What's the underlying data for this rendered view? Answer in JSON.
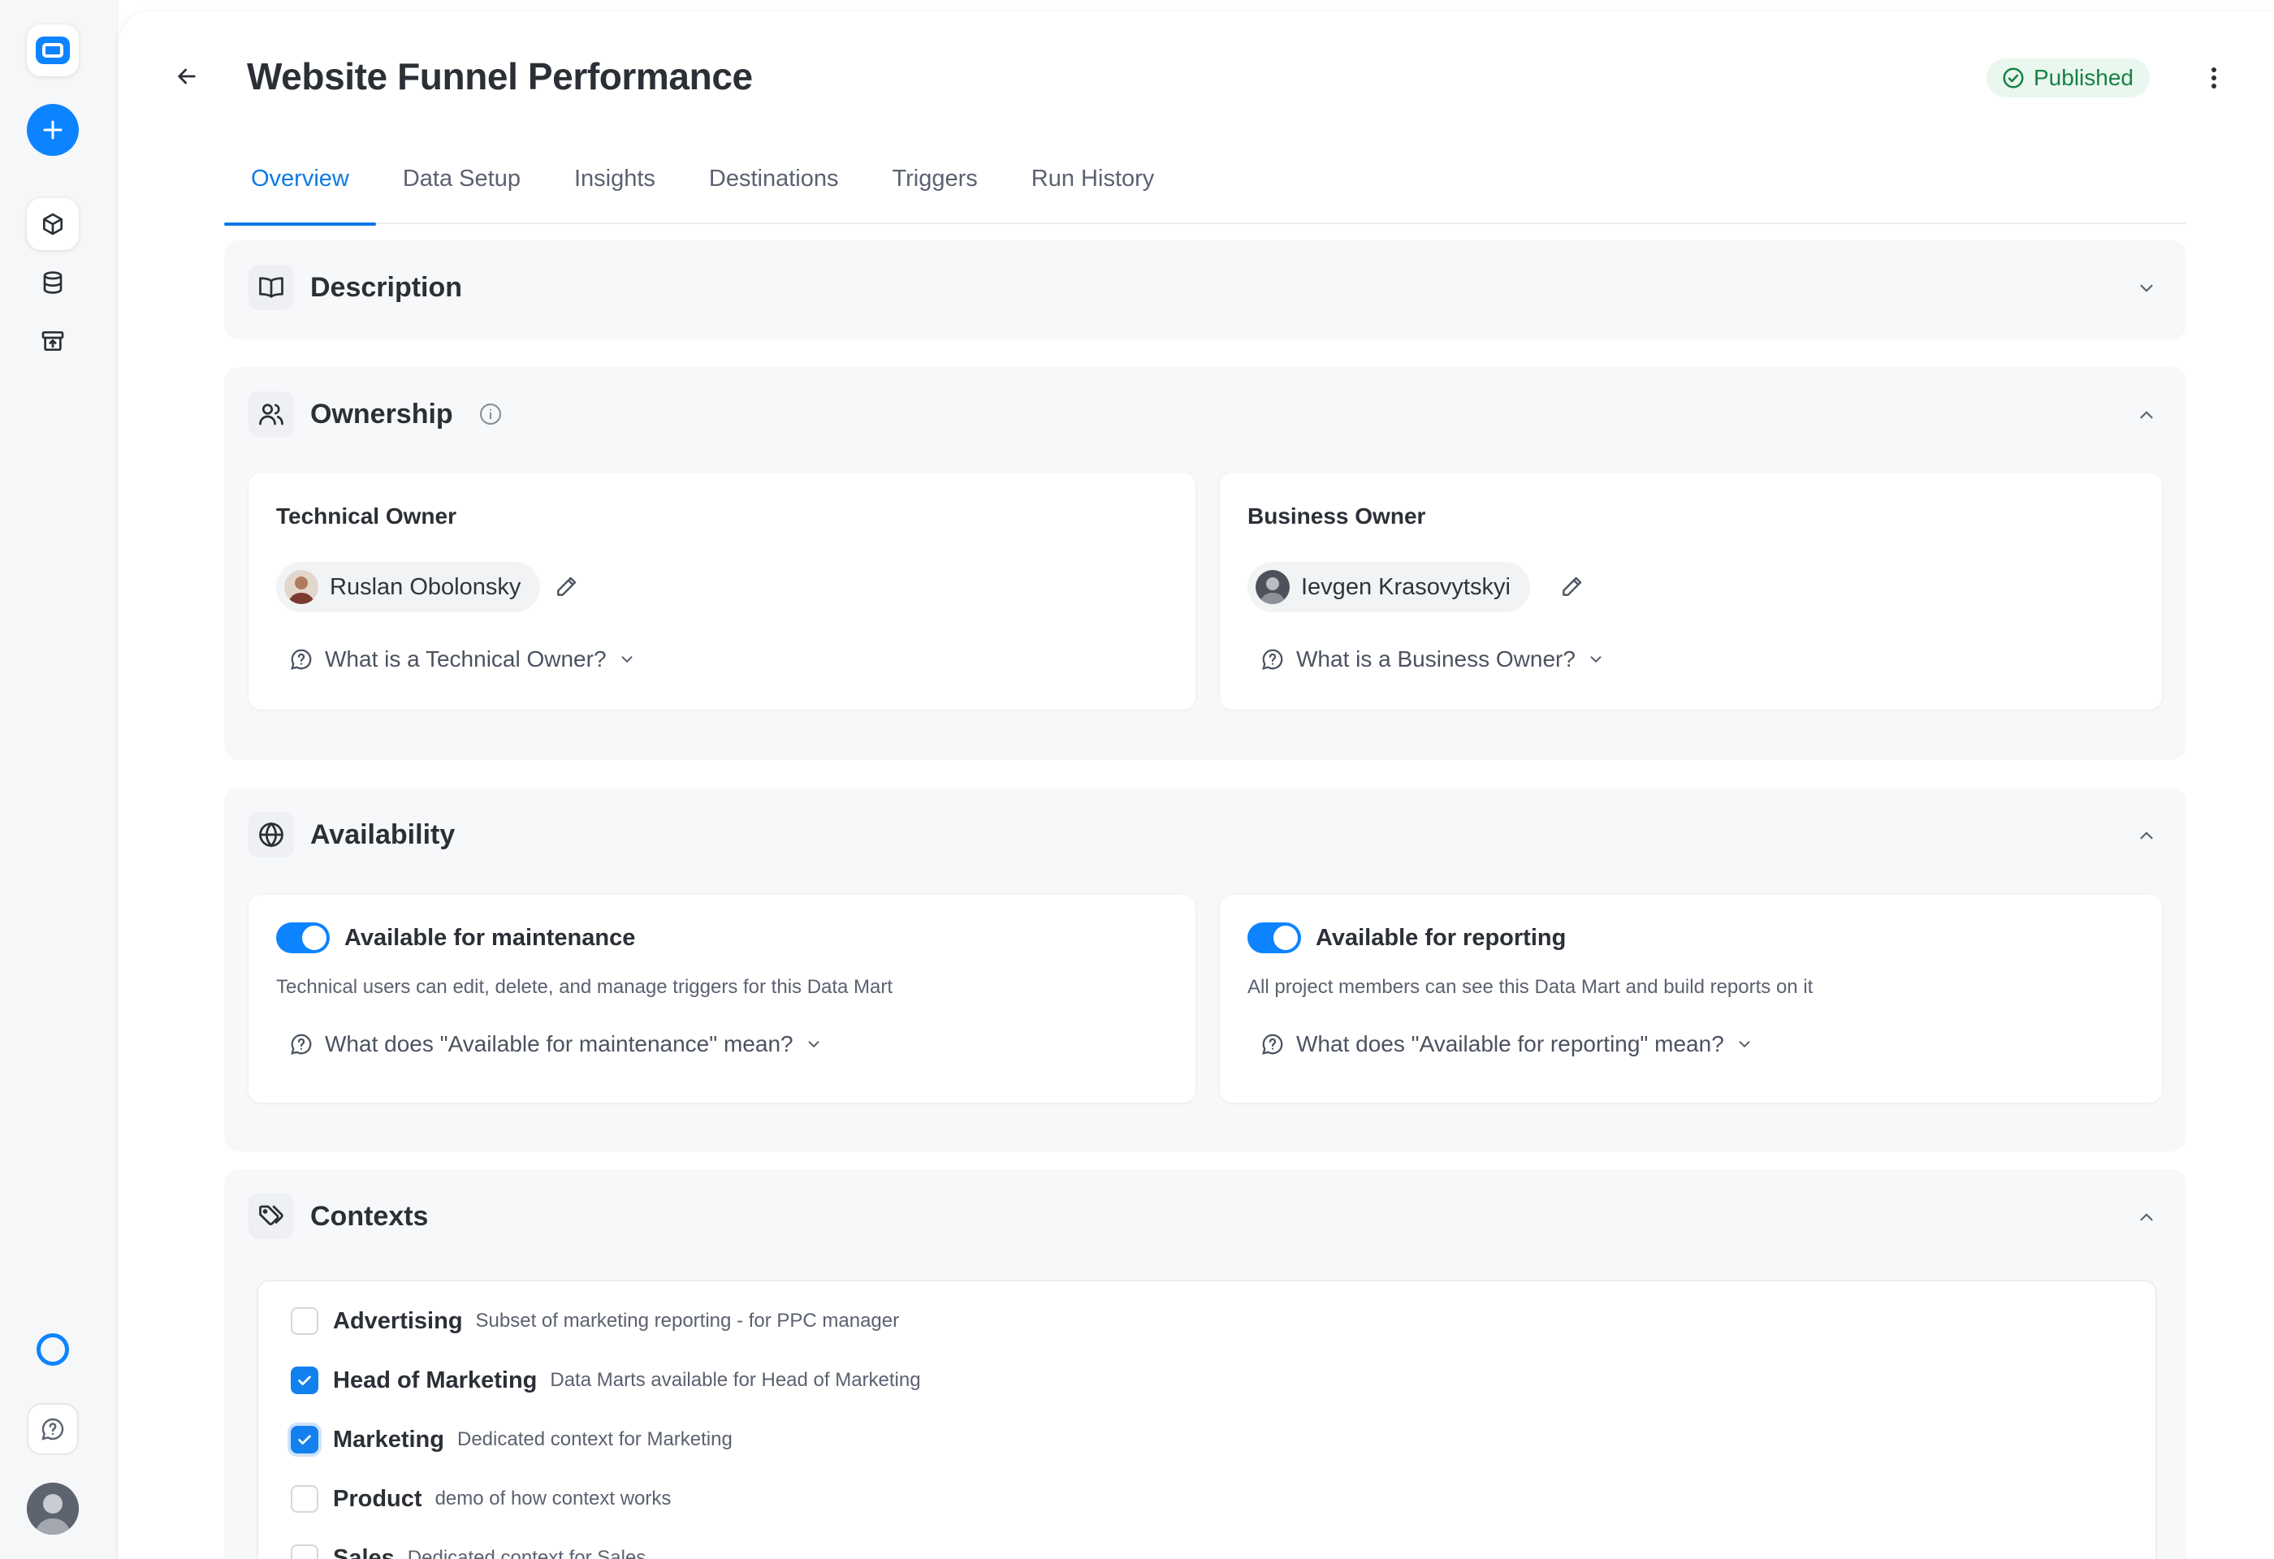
{
  "page": {
    "title": "Website Funnel Performance",
    "status": "Published"
  },
  "tabs": [
    "Overview",
    "Data Setup",
    "Insights",
    "Destinations",
    "Triggers",
    "Run History"
  ],
  "active_tab": "Overview",
  "sections": {
    "description": {
      "title": "Description"
    },
    "ownership": {
      "title": "Ownership",
      "technical": {
        "label": "Technical Owner",
        "name": "Ruslan Obolonsky",
        "help": "What is a Technical Owner?"
      },
      "business": {
        "label": "Business Owner",
        "name": "Ievgen Krasovytskyi",
        "help": "What is a Business Owner?"
      }
    },
    "availability": {
      "title": "Availability",
      "maintenance": {
        "label": "Available for maintenance",
        "enabled": true,
        "desc": "Technical users can edit, delete, and manage triggers for this Data Mart",
        "help": "What does \"Available for maintenance\" mean?"
      },
      "reporting": {
        "label": "Available for reporting",
        "enabled": true,
        "desc": "All project members can see this Data Mart and build reports on it",
        "help": "What does \"Available for reporting\" mean?"
      }
    },
    "contexts": {
      "title": "Contexts",
      "items": [
        {
          "name": "Advertising",
          "desc": "Subset of marketing reporting - for PPC manager",
          "checked": false
        },
        {
          "name": "Head of Marketing",
          "desc": "Data Marts available for Head of Marketing",
          "checked": true
        },
        {
          "name": "Marketing",
          "desc": "Dedicated context for Marketing",
          "checked": true
        },
        {
          "name": "Product",
          "desc": "demo of how context works",
          "checked": false
        },
        {
          "name": "Sales",
          "desc": "Dedicated context for Sales",
          "checked": false
        }
      ]
    }
  },
  "colors": {
    "accent": "#0d84ff",
    "published_bg": "#e9f7ee",
    "published_text": "#178044"
  }
}
